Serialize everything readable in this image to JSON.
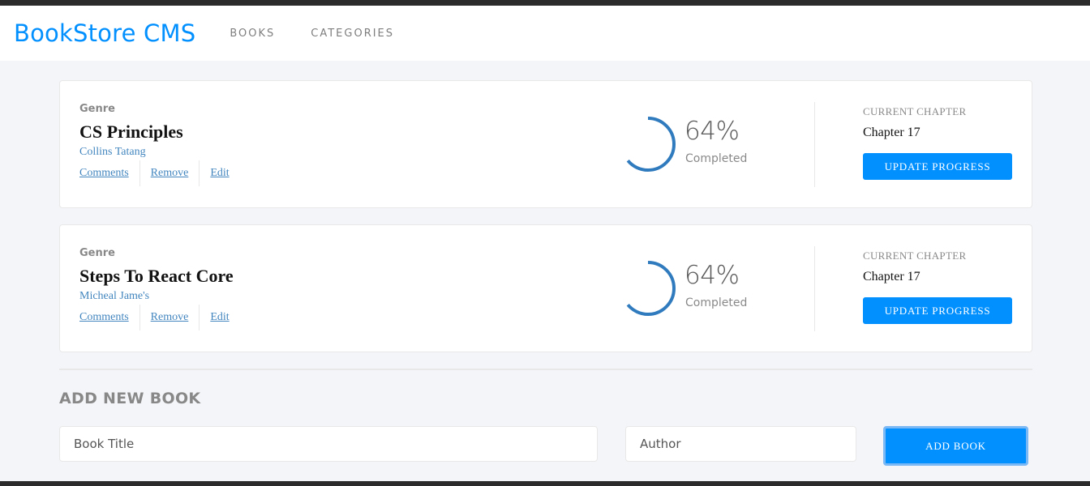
{
  "navbar": {
    "brand": "BookStore CMS",
    "links": [
      "BOOKS",
      "CATEGORIES"
    ]
  },
  "books": [
    {
      "genre": "Genre",
      "title": "CS Principles",
      "author": "Collins Tatang",
      "actions": [
        "Comments",
        "Remove",
        "Edit"
      ],
      "progress": {
        "value": 0.64,
        "percent_label": "64%",
        "status": "Completed"
      },
      "current_chapter_label": "CURRENT CHAPTER",
      "current_chapter": "Chapter 17",
      "update_button": "UPDATE PROGRESS"
    },
    {
      "genre": "Genre",
      "title": "Steps To React Core",
      "author": "Micheal Jame's",
      "actions": [
        "Comments",
        "Remove",
        "Edit"
      ],
      "progress": {
        "value": 0.64,
        "percent_label": "64%",
        "status": "Completed"
      },
      "current_chapter_label": "CURRENT CHAPTER",
      "current_chapter": "Chapter 17",
      "update_button": "UPDATE PROGRESS"
    }
  ],
  "form": {
    "heading": "ADD NEW BOOK",
    "title_placeholder": "Book Title",
    "author_placeholder": "Author",
    "submit_label": "ADD BOOK"
  },
  "colors": {
    "accent": "#0290ff",
    "link": "#4386bf",
    "progress_stroke": "#307bbe",
    "background": "#f4f5f8"
  }
}
